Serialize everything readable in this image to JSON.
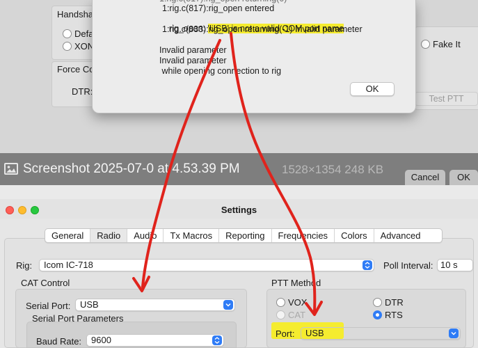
{
  "top_window": {
    "handshake_label": "Handsha",
    "handshake_default": "Defa",
    "handshake_xon": "XON",
    "force_control_label": "Force Co",
    "dtr_label": "DTR:",
    "fake_it_label": "Fake It",
    "test_ptt_label": "Test PTT"
  },
  "error_dialog": {
    "lines": [
      "1:rig.c(817):rig_open entered",
      "rig_open: ",
      "'USB' is not a valid COM port name",
      "1:rig.c(833):rig_open returning(-1) Invalid parameter",
      "Invalid parameter",
      "Invalid parameter",
      " while opening connection to rig"
    ],
    "ok_label": "OK"
  },
  "preview_bar": {
    "title": "Screenshot 2025-07-0",
    "title_tail": " at 4.53.39 PM",
    "meta": "1528×1354 248 KB",
    "cancel_label": "Cancel",
    "ok_label": "OK"
  },
  "settings": {
    "title": "Settings",
    "tabs": [
      {
        "label": "General"
      },
      {
        "label": "Radio"
      },
      {
        "label": "Audio"
      },
      {
        "label": "Tx Macros"
      },
      {
        "label": "Reporting"
      },
      {
        "label": "Frequencies"
      },
      {
        "label": "Colors"
      },
      {
        "label": "Advanced"
      }
    ],
    "rig_label": "Rig:",
    "rig_value": "Icom IC-718",
    "poll_interval_label": "Poll Interval:",
    "poll_interval_value": "10 s",
    "cat_control": {
      "title": "CAT Control",
      "serial_port_label": "Serial Port:",
      "serial_port_value": "USB",
      "serial_params_title": "Serial Port Parameters",
      "baud_rate_label": "Baud Rate:",
      "baud_rate_value": "9600"
    },
    "ptt_method": {
      "title": "PTT Method",
      "vox_label": "VOX",
      "dtr_label": "DTR",
      "cat_label": "CAT",
      "rts_label": "RTS",
      "port_label": "Port:",
      "port_value": "USB"
    }
  },
  "colors": {
    "accent": "#2f7cf6",
    "highlight": "#f5ec2f",
    "annotation": "#e0231c"
  }
}
